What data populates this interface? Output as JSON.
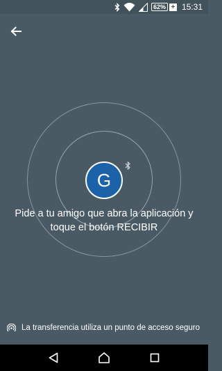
{
  "status_bar": {
    "battery_level": "62%",
    "battery_charging_symbol": "+",
    "time": "15:31",
    "icons": [
      "bluetooth-icon",
      "wifi-icon",
      "cell-signal-icon"
    ]
  },
  "header": {
    "back_icon": "arrow-left-icon"
  },
  "center": {
    "avatar_initial": "G",
    "avatar_color": "#1b62a8",
    "bluetooth_icon": "bluetooth-icon",
    "instruction": "Pide a tu amigo que abra la aplicación y toque el botón RECIBIR"
  },
  "footer": {
    "note_icon": "hotspot-icon",
    "note": "La transferencia utiliza un punto de acceso seguro"
  },
  "nav_bar": {
    "icons": [
      "back-triangle-icon",
      "home-circle-icon",
      "recents-square-icon"
    ]
  },
  "colors": {
    "background": "#4a5a64",
    "status_bar": "#42525b",
    "nav_bar": "#000000"
  }
}
